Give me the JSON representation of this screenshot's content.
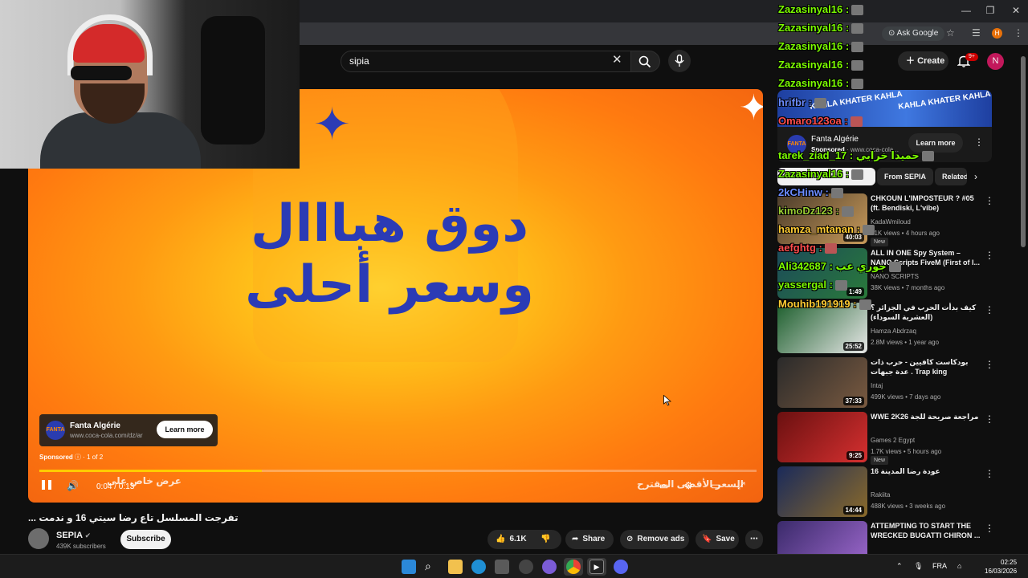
{
  "browser": {
    "ask_google": "Ask Google",
    "profile_letter": "H"
  },
  "youtube": {
    "search_value": "sipia",
    "create_label": "Create",
    "notif_badge": "9+",
    "avatar_letter": "N"
  },
  "player": {
    "ad_text_line1": "دوق هبااال",
    "ad_text_line2": "وسعر أحلى",
    "ad_advertiser": "Fanta Algérie",
    "ad_url": "www.coca-cola.com/dz/ar",
    "learn_more": "Learn more",
    "sponsored": "Sponsored",
    "ad_count": "1 of 2",
    "time": "0:04 / 0:13",
    "overlay_left": "عرض خاص على",
    "overlay_right": "السعر الأقصى المقترح",
    "progress_fraction": 0.31,
    "accent_color": "#ffcc00",
    "logo_text": "FANTA"
  },
  "video": {
    "title": "... تفرجت المسلسل تاع رضا سيتي 16 و ندمت",
    "channel": "SEPIA",
    "subscribers": "439K subscribers",
    "subscribe": "Subscribe",
    "likes": "6.1K",
    "share": "Share",
    "remove_ads": "Remove ads",
    "save": "Save"
  },
  "sidebar": {
    "ad": {
      "name": "Fanta Algérie",
      "sponsored": "Sponsored",
      "url": "www.coca-cola...",
      "learn_more": "Learn more",
      "banner_1": "KAHLA KHATER KAHLA",
      "banner_2": "KAHLA KHATER KAHLA"
    },
    "chips": [
      "From SEPIA",
      "Related"
    ],
    "recommendations": [
      {
        "title": "CHKOUN L'IMPOSTEUR ? #05 (ft. Bendiski, L'vibe)",
        "channel": "KadaWmiloud",
        "meta": "41K views • 4 hours ago",
        "duration": "40:03",
        "badge": "New"
      },
      {
        "title": "ALL IN ONE Spy System – NANO Scripts FiveM (First of I...",
        "channel": "NANO SCRIPTS",
        "meta": "38K views • 7 months ago",
        "duration": "1:49",
        "badge": ""
      },
      {
        "title": "كيف بدأت الحرب في الجزائر ؟ (العشرية السوداء)",
        "channel": "Hamza Abdrzaq",
        "meta": "2.8M views • 1 year ago",
        "duration": "25:52",
        "badge": ""
      },
      {
        "title": "بودكاست كافيين - حرب ذات عدة جبهات . Trap king",
        "channel": "Intaj",
        "meta": "499K views • 7 days ago",
        "duration": "37:33",
        "badge": ""
      },
      {
        "title": "WWE 2K26 مراجعة صريحة للجة",
        "channel": "Games 2 Egypt",
        "meta": "1.7K views • 5 hours ago",
        "duration": "9:25",
        "badge": "New"
      },
      {
        "title": "عودة رضا المدينة 16",
        "channel": "Rakiita",
        "meta": "488K views • 3 weeks ago",
        "duration": "14:44",
        "badge": ""
      },
      {
        "title": "ATTEMPTING TO START THE WRECKED BUGATTI CHIRON ...",
        "channel": "",
        "meta": "",
        "duration": "",
        "badge": ""
      }
    ]
  },
  "chat": [
    {
      "text": "Zazasinyal16 :",
      "color": "#7cfc00"
    },
    {
      "text": "Zazasinyal16 :",
      "color": "#7cfc00"
    },
    {
      "text": "Zazasinyal16 :",
      "color": "#7cfc00"
    },
    {
      "text": "Zazasinyal16 :",
      "color": "#7cfc00"
    },
    {
      "text": "Zazasinyal16 :",
      "color": "#7cfc00"
    },
    {
      "text": "hrifbr :",
      "color": "#6b8cff"
    },
    {
      "text": "Omaro123oa :",
      "color": "#ff4d4d"
    },
    {
      "text": "tarek_ziad_17 : حميدا خرايي",
      "color": "#7cfc00"
    },
    {
      "text": "Zazasinyal16 :",
      "color": "#7cfc00"
    },
    {
      "text": "2kCHinw :",
      "color": "#6b8cff"
    },
    {
      "text": "kimoDz123 :",
      "color": "#9acd32"
    },
    {
      "text": "hamza_mtanan :",
      "color": "#ffcc33"
    },
    {
      "text": "aefghtg :",
      "color": "#ff4d4d"
    },
    {
      "text": "Ali342687 : جوري عب",
      "color": "#7cfc00"
    },
    {
      "text": "yassergal :",
      "color": "#7cfc00"
    },
    {
      "text": "Mouhib191919 :",
      "color": "#ffcc33"
    }
  ],
  "taskbar": {
    "lang": "FRA",
    "time": "02:25",
    "date": "16/03/2026"
  }
}
